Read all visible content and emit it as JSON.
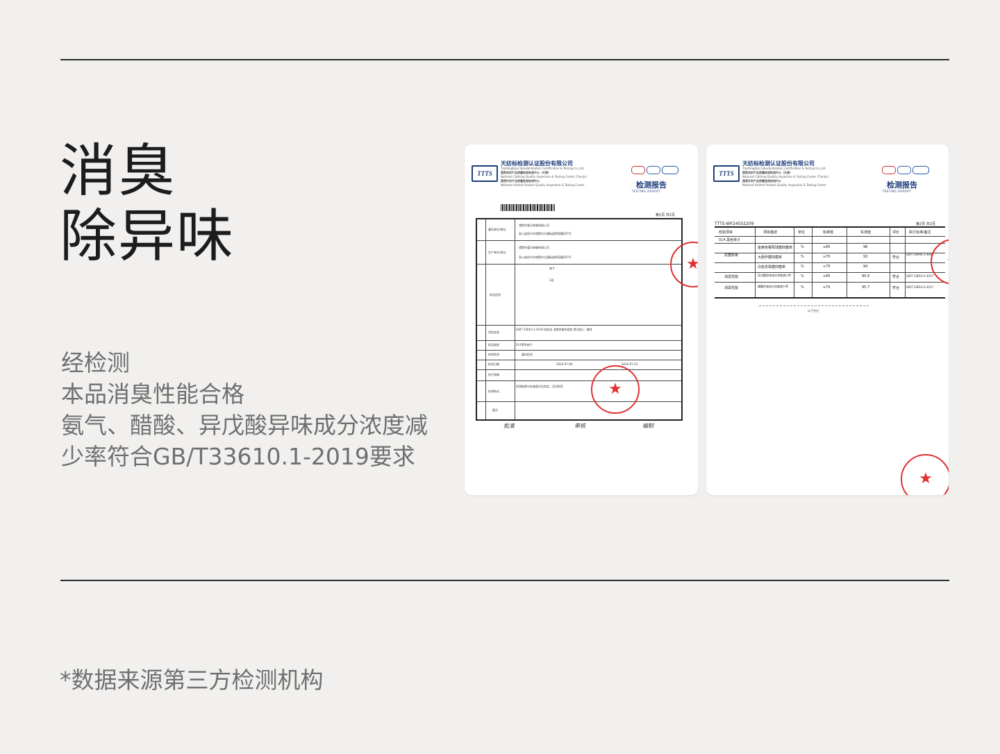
{
  "headline": {
    "line1": "消臭",
    "line2": "除异味"
  },
  "body": {
    "line1": "经检测",
    "line2": "本品消臭性能合格",
    "line3": "氨气、醋酸、异戊酸异味成分浓度减",
    "line4": "少率符合GB/T33610.1-2019要求"
  },
  "footnote": "*数据来源第三方检测机构",
  "report": {
    "logo": "TTTS",
    "org_name": "天纺标检测认证股份有限公司",
    "org_sub1": "Tianfangbiao Standardization Certification & Testing Co.,Ltd.",
    "org_center1": "国家纺织产品质量检验检测中心（天津）",
    "org_sub2": "National Clothing Quality Inspection & Testing Center (Tianjin)",
    "org_center2": "国家针织产品质量检验检测中心",
    "org_sub3": "National Knitted Product Quality Inspection & Testing Center",
    "title": "检测报告",
    "title_en": "TESTING REPORT",
    "page1": "第1页 共2页",
    "page2": "第2页 共2页",
    "report_no": "TTTS-WF24552209",
    "end_mark": "以下空白"
  },
  "page1": {
    "labels": [
      "委托单位/地址",
      "生产单位/地址",
      "样品信息",
      "判定标准",
      "样品描述",
      "检验性质",
      "检验日期",
      "执行措施",
      "检测结论",
      "备注"
    ],
    "client": "诸暨市爱乐袜服有限公司",
    "client_addr": "浙江省绍兴市诸暨市大唐街道草塔镇267号",
    "sample_name": "袜子",
    "sample_count": "1双",
    "standard": "GB/T 33610.1-2019 纺织品 消臭性能的测定 第1部分：通则",
    "sample_desc": "014黑色袜子",
    "check_type": "委托检验",
    "date_received": "2024-07-09",
    "date_issued": "2024-07-23",
    "conclusion": "检测结果与标准值对比判定，详见附页",
    "signers": [
      "批准",
      "审核",
      "编制"
    ]
  },
  "page2": {
    "headers": [
      "检验项目",
      "项目描述",
      "单位",
      "标准值",
      "实测值",
      "评价",
      "执行标准/备注"
    ],
    "sample": "014  黑色袜子",
    "rows": [
      {
        "item": "抗菌效果",
        "desc": "金黄色葡萄球菌抑菌率",
        "unit": "%",
        "std": "≥85",
        "val": "98",
        "eval": "符合"
      },
      {
        "item": "",
        "desc": "大肠杆菌抑菌率",
        "unit": "%",
        "std": "≥70",
        "val": "93",
        "eval": ""
      },
      {
        "item": "",
        "desc": "白色念珠菌抑菌率",
        "unit": "%",
        "std": "≥70",
        "val": "94",
        "eval": ""
      },
      {
        "item": "消臭性能",
        "desc": "异戊酸异味成分浓度减少率",
        "unit": "%",
        "std": "≥85",
        "val": "90.6",
        "eval": "符合"
      },
      {
        "item": "消臭性能",
        "desc": "醋酸异味成分浓度减少率",
        "unit": "%",
        "std": "≥70",
        "val": "95.7",
        "eval": "符合"
      }
    ],
    "std_note_1": "GB/T 20944.3-2008",
    "std_note_2": "GB/T 33610.2-2017"
  },
  "colors": {
    "stamp": "#e03030",
    "brand": "#1d3d7a",
    "rule": "#2a2a2a",
    "text_gray": "#6f6f6f"
  }
}
